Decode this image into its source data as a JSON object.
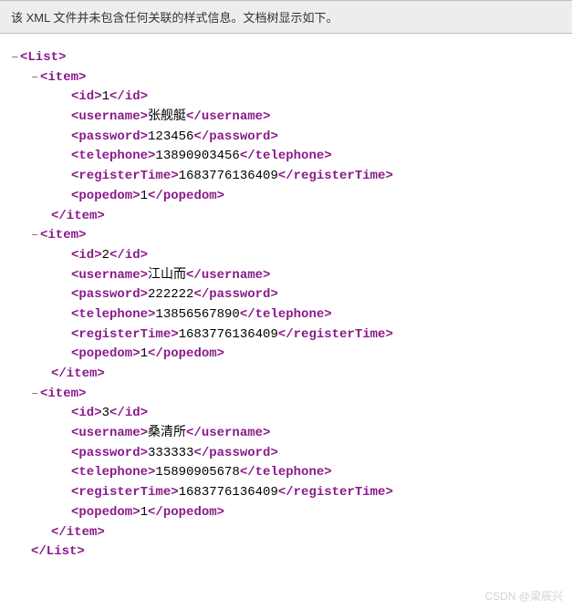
{
  "header": "该 XML 文件并未包含任何关联的样式信息。文档树显示如下。",
  "rootTag": "List",
  "itemTag": "item",
  "toggle": "–",
  "fields": [
    "id",
    "username",
    "password",
    "telephone",
    "registerTime",
    "popedom"
  ],
  "items": [
    {
      "id": "1",
      "username": "张舰艇",
      "password": "123456",
      "telephone": "13890903456",
      "registerTime": "1683776136409",
      "popedom": "1"
    },
    {
      "id": "2",
      "username": "江山而",
      "password": "222222",
      "telephone": "13856567890",
      "registerTime": "1683776136409",
      "popedom": "1"
    },
    {
      "id": "3",
      "username": "桑清所",
      "password": "333333",
      "telephone": "15890905678",
      "registerTime": "1683776136409",
      "popedom": "1"
    }
  ],
  "watermark": "CSDN @梁辰兴"
}
